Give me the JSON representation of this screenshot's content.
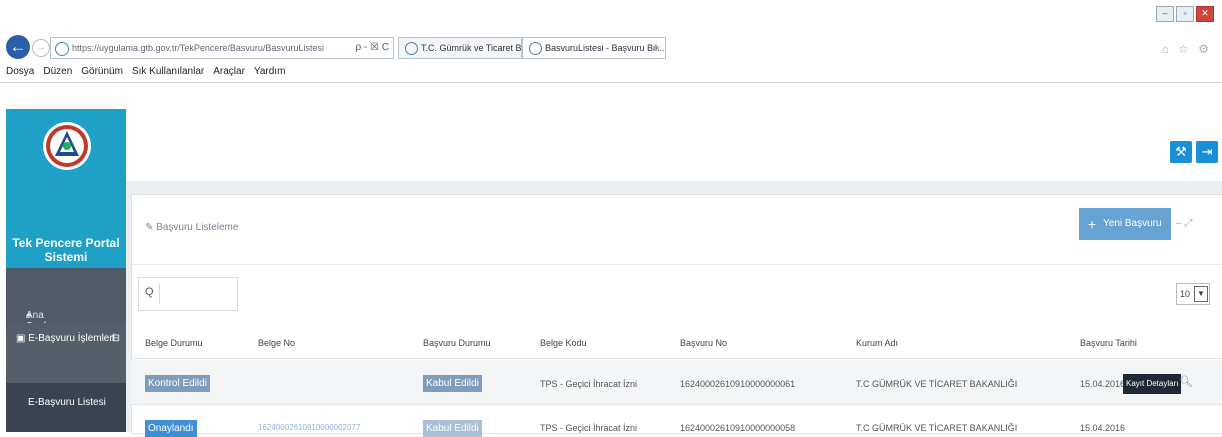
{
  "window": {
    "min": "–",
    "max": "▫",
    "close": "✕"
  },
  "browser": {
    "back": "←",
    "forward": "→",
    "address": "https://uygulama.gtb.gov.tr/TekPencere/Basvuru/BasvuruListesi",
    "address_tools": "ρ - ☒ C",
    "tabs": [
      {
        "label": "T.C. Gümrük ve Ticaret Bakanl..."
      },
      {
        "label": "BasvuruListesi - Başvuru Bil...",
        "close": "×"
      }
    ],
    "right_tools": "⌂ ☆ ⚙"
  },
  "menubar": [
    "Dosya",
    "Düzen",
    "Görünüm",
    "Sık Kullanılanlar",
    "Araçlar",
    "Yardım"
  ],
  "sidebar": {
    "brand": "Tek Pencere Portal Sistemi",
    "items": [
      {
        "label": "Ana Sayfa",
        "icon": "home-icon"
      },
      {
        "label": "E-Başvuru İşlemleri",
        "icon": "list-icon",
        "toggle": "⊟"
      },
      {
        "label": "E-Başvuru Listesi"
      }
    ]
  },
  "header": {
    "btn1": "⚒",
    "btn2": "⇥"
  },
  "panel": {
    "title": "Başvuru Listeleme",
    "new_button": "Yeni Başvuru Ekle",
    "new_button_icon": "+",
    "controls": "–  ⤢",
    "search_icon": "Q",
    "page_size": "10",
    "page_size_arrow": "▼"
  },
  "table": {
    "headers": [
      "Belge Durumu",
      "Belge No",
      "Başvuru Durumu",
      "Belge Kodu",
      "Başvuru No",
      "Kurum Adı",
      "Başvuru Tarihi"
    ],
    "rows": [
      {
        "belge_durumu": "Kontrol Edildi",
        "belge_no": "",
        "basvuru_durumu": "Kabul Edildi",
        "belge_kodu": "TPS - Geçici İhracat İzni",
        "basvuru_no": "16240002610910000000061",
        "kurum_adi": "T.C GÜMRÜK VE TİCARET BAKANLIĞI",
        "tarih": "15.04.2016",
        "action": "Kayıt Detayları"
      },
      {
        "belge_durumu": "Onaylandı",
        "belge_no": "16240002610910000002077",
        "basvuru_durumu": "Kabul Edildi",
        "belge_kodu": "TPS - Geçici İhracat İzni",
        "basvuru_no": "16240002610910000000058",
        "kurum_adi": "T.C GÜMRÜK VE TİCARET BAKANLIĞI",
        "tarih": "15.04.2016",
        "action": ""
      }
    ]
  },
  "colors": {
    "brand": "#1fa0c6",
    "sidebar": "#2c3e50",
    "accent": "#1a8fd8",
    "badge": "#7f9dbb",
    "action": "#1d2a36"
  }
}
